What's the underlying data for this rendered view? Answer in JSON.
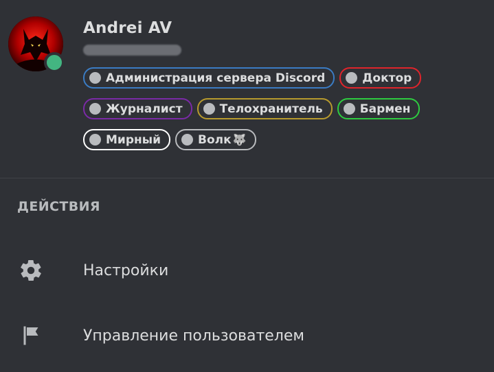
{
  "profile": {
    "username": "Andrei AV",
    "status": "online",
    "status_color": "#43b581"
  },
  "roles": [
    {
      "name": "Администрация сервера Discord",
      "color": "#3b7cc4"
    },
    {
      "name": "Доктор",
      "color": "#e0242b"
    },
    {
      "name": "Журналист",
      "color": "#7b2aa7"
    },
    {
      "name": "Телохранитель",
      "color": "#b89b2d"
    },
    {
      "name": "Бармен",
      "color": "#2ecc40"
    },
    {
      "name": "Мирный",
      "color": "#ffffff"
    },
    {
      "name": "Волк",
      "emoji": "🐺",
      "color": "#b9bbbe"
    }
  ],
  "actions_section": {
    "title": "ДЕЙСТВИЯ",
    "items": [
      {
        "label": "Настройки",
        "icon": "gear-icon"
      },
      {
        "label": "Управление пользователем",
        "icon": "flag-icon"
      }
    ]
  },
  "theme": {
    "background": "#2f3136",
    "text": "#dcddde",
    "muted": "#b9bbbe"
  }
}
